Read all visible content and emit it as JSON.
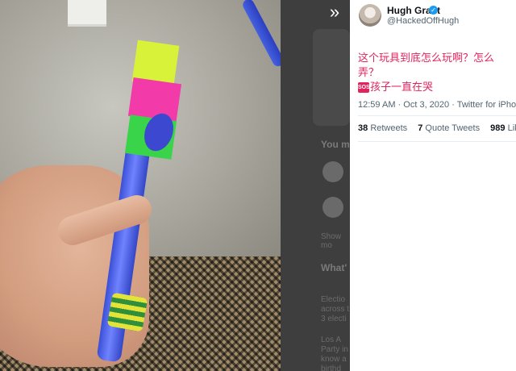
{
  "viewer": {
    "collapse_icon": "»",
    "ghost": {
      "section1": "You m",
      "show_more": "Show mo",
      "section2": "What'",
      "news": [
        "Electio",
        "across t",
        "3 electi"
      ],
      "news2": [
        "Los A",
        "Party in",
        "know a",
        "birthd"
      ]
    }
  },
  "tweet": {
    "author_name": "Hugh Grant",
    "author_handle": "@HackedOffHugh",
    "text_line1": "这个玩具到底怎么玩啊？怎么弄？",
    "sos_label": "SOS",
    "text_line2": "孩子一直在哭",
    "time": "12:59 AM",
    "date": "Oct 3, 2020",
    "source": "Twitter for iPhone",
    "retweets_count": "38",
    "retweets_label": "Retweets",
    "quotes_count": "7",
    "quotes_label": "Quote Tweets",
    "likes_count": "989",
    "likes_label": "Likes"
  },
  "colors": {
    "accent": "#1d9bf0",
    "tweet_text": "#e0245e",
    "secondary_text": "#536471"
  }
}
